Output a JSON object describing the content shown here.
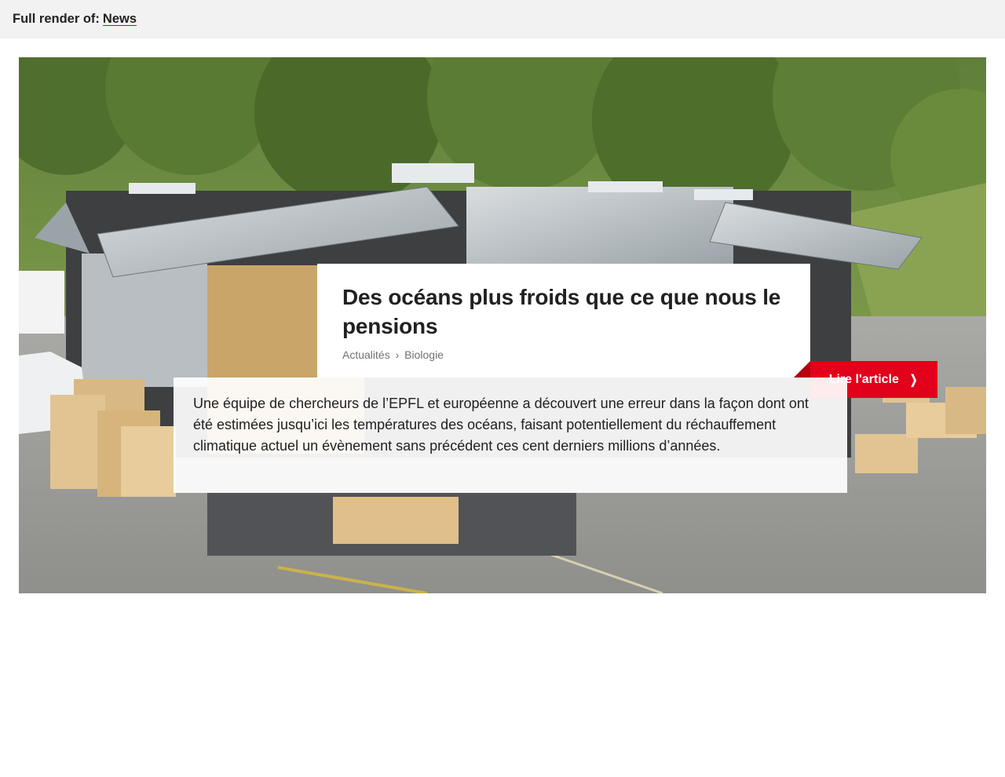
{
  "header": {
    "prefix": "Full render of:",
    "link_label": "News"
  },
  "article": {
    "title": "Des océans plus froids que ce que nous le pensions",
    "breadcrumb": [
      "Actualités",
      "Biologie"
    ],
    "breadcrumb_separator": "›",
    "lead": "Une équipe de chercheurs de l’EPFL et européenne a découvert une erreur dans la façon dont ont été estimées jusqu’ici les températures des océans, faisant potentiellement du réchauffement climatique actuel un évènement sans précédent ces cent derniers millions d’années.",
    "button_label": "Lire l'article",
    "button_icon": "chevron-right-icon"
  },
  "colors": {
    "accent": "#e2001a",
    "header_bg": "#f2f2f3"
  }
}
